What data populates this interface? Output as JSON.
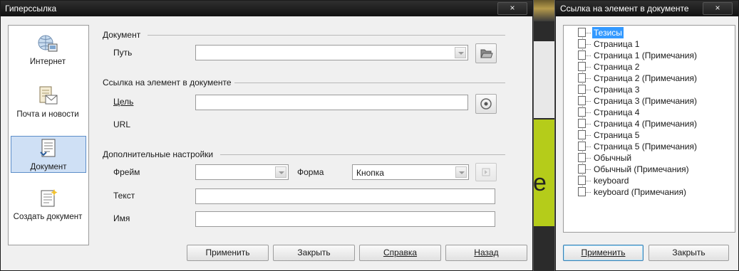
{
  "main_dialog": {
    "title": "Гиперссылка",
    "close_glyph": "×",
    "sidebar": {
      "items": [
        {
          "label": "Интернет",
          "icon": "globe-icon",
          "selected": false
        },
        {
          "label": "Почта и новости",
          "icon": "mail-icon",
          "selected": false
        },
        {
          "label": "Документ",
          "icon": "document-icon",
          "selected": true
        },
        {
          "label": "Создать документ",
          "icon": "new-document-icon",
          "selected": false
        }
      ]
    },
    "document_section": {
      "title": "Документ",
      "path_label": "Путь",
      "path_value": "",
      "open_file_icon": "folder-icon"
    },
    "target_section": {
      "title": "Ссылка на элемент в документе",
      "target_label": "Цель",
      "target_value": "",
      "url_label": "URL",
      "target_button_icon": "target-icon"
    },
    "extra_section": {
      "title": "Дополнительные настройки",
      "frame_label": "Фрейм",
      "frame_value": "",
      "form_label": "Форма",
      "form_value": "Кнопка",
      "events_icon": "events-icon",
      "text_label": "Текст",
      "text_value": "",
      "name_label": "Имя",
      "name_value": ""
    },
    "buttons": {
      "apply": "Применить",
      "close": "Закрыть",
      "help": "Справка",
      "back": "Назад"
    }
  },
  "nav_dialog": {
    "title": "Ссылка на элемент в документе",
    "close_glyph": "×",
    "items": [
      "Тезисы",
      "Страница 1",
      "Страница 1 (Примечания)",
      "Страница 2",
      "Страница 2 (Примечания)",
      "Страница 3",
      "Страница 3 (Примечания)",
      "Страница 4",
      "Страница 4 (Примечания)",
      "Страница 5",
      "Страница 5 (Примечания)",
      "Обычный",
      "Обычный (Примечания)",
      "keyboard",
      "keyboard (Примечания)"
    ],
    "selected_index": 0,
    "buttons": {
      "apply": "Применить",
      "close": "Закрыть"
    }
  },
  "background": {
    "slide_text": "е П"
  }
}
